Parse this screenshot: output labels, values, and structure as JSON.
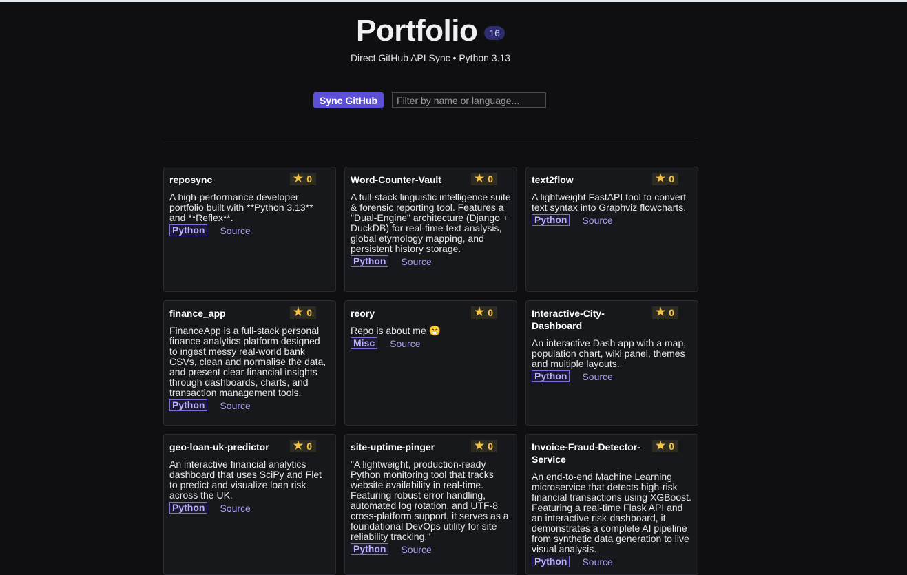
{
  "header": {
    "title": "Portfolio",
    "count": "16",
    "subtitle": "Direct GitHub API Sync • Python 3.13"
  },
  "controls": {
    "sync_label": "Sync GitHub",
    "filter_placeholder": "Filter by name or language..."
  },
  "colors": {
    "accent": "#5b50d6",
    "star": "#f5c542",
    "tag": "#b9b0ff",
    "background": "#0f0f11",
    "card": "#17181b"
  },
  "repos": [
    {
      "name": "reposync",
      "stars": "0",
      "description": "A high-performance developer portfolio built with **Python 3.13** and **Reflex**.",
      "language": "Python",
      "source_label": "Source"
    },
    {
      "name": "Word-Counter-Vault",
      "stars": "0",
      "description": "A full-stack linguistic intelligence suite & forensic reporting tool. Features a \"Dual-Engine\" architecture (Django + DuckDB) for real-time text analysis, global etymology mapping, and persistent history storage.",
      "language": "Python",
      "source_label": "Source"
    },
    {
      "name": "text2flow",
      "stars": "0",
      "description": "A lightweight FastAPI tool to convert text syntax into Graphviz flowcharts.",
      "language": "Python",
      "source_label": "Source"
    },
    {
      "name": "finance_app",
      "stars": "0",
      "description": "FinanceApp is a full-stack personal finance analytics platform designed to ingest messy real-world bank CSVs, clean and normalise the data, and present clear financial insights through dashboards, charts, and transaction management tools.",
      "language": "Python",
      "source_label": "Source"
    },
    {
      "name": "reory",
      "stars": "0",
      "description": "Repo is about me 😁",
      "language": "Misc",
      "source_label": "Source"
    },
    {
      "name": "Interactive-City-Dashboard",
      "stars": "0",
      "description": "An interactive Dash app with a map, population chart, wiki panel, themes and multiple layouts.",
      "language": "Python",
      "source_label": "Source"
    },
    {
      "name": "geo-loan-uk-predictor",
      "stars": "0",
      "description": "An interactive financial analytics dashboard that uses SciPy and Flet to predict and visualize loan risk across the UK.",
      "language": "Python",
      "source_label": "Source"
    },
    {
      "name": "site-uptime-pinger",
      "stars": "0",
      "description": "\"A lightweight, production-ready Python monitoring tool that tracks website availability in real-time. Featuring robust error handling, automated log rotation, and UTF-8 cross-platform support, it serves as a foundational DevOps utility for site reliability tracking.\"",
      "language": "Python",
      "source_label": "Source"
    },
    {
      "name": "Invoice-Fraud-Detector-Service",
      "stars": "0",
      "description": "An end-to-end Machine Learning microservice that detects high-risk financial transactions using XGBoost. Featuring a real-time Flask API and an interactive risk-dashboard, it demonstrates a complete AI pipeline from synthetic data generation to live visual analysis.",
      "language": "Python",
      "source_label": "Source"
    }
  ]
}
